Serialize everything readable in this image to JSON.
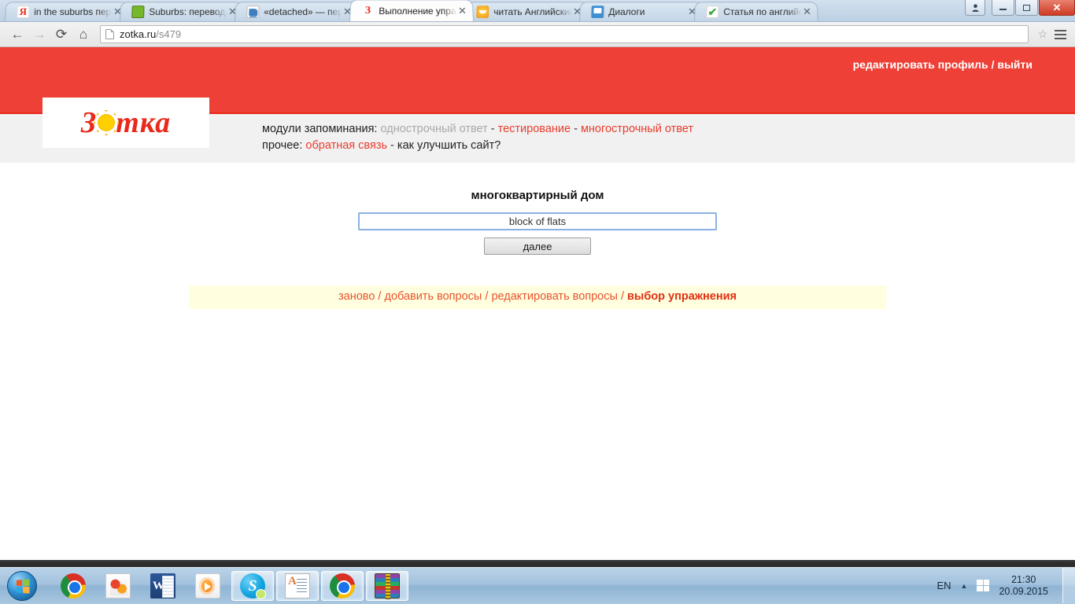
{
  "browser": {
    "tabs": [
      {
        "title": "in the suburbs перев",
        "favicon": "yandex-icon",
        "active": false
      },
      {
        "title": "Suburbs: перевод, тр",
        "favicon": "green-square-icon",
        "active": false
      },
      {
        "title": "«detached» — перев",
        "favicon": "dictionary-book-icon",
        "active": false
      },
      {
        "title": "Выполнение упражн",
        "favicon": "zotka-icon",
        "active": true
      },
      {
        "title": "читать Английский я",
        "favicon": "orange-face-icon",
        "active": false
      },
      {
        "title": "Диалоги",
        "favicon": "chat-bubble-icon",
        "active": false
      },
      {
        "title": "Статья по английско",
        "favicon": "green-check-icon",
        "active": false
      }
    ],
    "tab_close_label": "✕",
    "nav": {
      "back": "←",
      "forward": "→",
      "reload": "⟳",
      "home": "⌂"
    },
    "address": {
      "domain": "zotka.ru",
      "path": "/s479"
    },
    "star_label": "☆",
    "window_controls": {
      "minimize": "—",
      "maximize": "❐",
      "close": "✕"
    }
  },
  "site": {
    "logo": {
      "before": "З",
      "after": "тка"
    },
    "header_links": {
      "edit_profile": "редактировать профиль",
      "separator": " / ",
      "logout": "выйти"
    },
    "menu": {
      "line1_label": "модули запоминания:",
      "single_line_answer": "однострочный ответ",
      "testing": "тестирование",
      "multiline_answer": "многострочный ответ",
      "line2_label": "прочее:",
      "feedback": "обратная связь",
      "improve": "как улучшить сайт?",
      "dash": " - "
    },
    "exercise": {
      "question": "многоквартирный дом",
      "answer_value": "block of flats",
      "next_button": "далее"
    },
    "footer_links": {
      "restart": "заново",
      "add_questions": "добавить вопросы",
      "edit_questions": "редактировать вопросы",
      "choose_exercise": "выбор упражнения",
      "separator": " / "
    },
    "colors": {
      "brand_red": "#ee4036",
      "link_red": "#ea3c2d",
      "menu_bg": "#f1f1f1",
      "footer_bg": "#ffffe0",
      "input_border": "#8cb0e3"
    }
  },
  "taskbar": {
    "start": "start-orb",
    "items": [
      {
        "name": "chrome",
        "running": false
      },
      {
        "name": "photo-viewer",
        "running": false
      },
      {
        "name": "word",
        "running": false
      },
      {
        "name": "media-player",
        "running": false
      },
      {
        "name": "skype",
        "running": true
      },
      {
        "name": "document",
        "running": true
      },
      {
        "name": "chrome-window",
        "running": true
      },
      {
        "name": "winrar",
        "running": true
      }
    ],
    "tray": {
      "language": "EN",
      "arrow": "▲",
      "time": "21:30",
      "date": "20.09.2015"
    }
  }
}
